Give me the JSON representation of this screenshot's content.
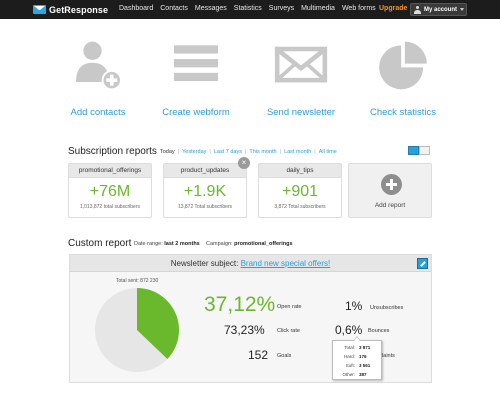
{
  "app": {
    "brand": "GetResponse",
    "brand_color": "#2aa8df"
  },
  "nav": {
    "items": [
      "Dashboard",
      "Contacts",
      "Messages",
      "Statistics",
      "Surveys",
      "Multimedia",
      "Web forms"
    ],
    "upgrade_label": "Upgrade",
    "account_label": "My account"
  },
  "actions": [
    {
      "label": "Add contacts",
      "icon": "add-contact-icon"
    },
    {
      "label": "Create webform",
      "icon": "webform-icon"
    },
    {
      "label": "Send newsletter",
      "icon": "envelope-icon"
    },
    {
      "label": "Check statistics",
      "icon": "pie-chart-icon"
    }
  ],
  "subscription": {
    "title": "Subscription reports",
    "periods": [
      "Today",
      "Yesterday",
      "Last 7 days",
      "This month",
      "Last month",
      "All time"
    ],
    "cards": [
      {
        "name": "promotional_offerings",
        "delta": "+76M",
        "subtitle": "1,013,872 total subscribers"
      },
      {
        "name": "product_updates",
        "delta": "+1.9K",
        "subtitle": "13,872 Total subscribers"
      },
      {
        "name": "daily_tips",
        "delta": "+901",
        "subtitle": "3,872 Total subscribers"
      }
    ],
    "add_label": "Add report",
    "close_glyph": "×"
  },
  "custom": {
    "title": "Custom report",
    "date_range_label": "Date range:",
    "date_range_value": "last 2 months",
    "campaign_label": "Campaign:",
    "campaign_value": "promotional_offerings",
    "subject_prefix": "Newsletter subject:",
    "subject_link": "Brand new special offers!",
    "total_sent": "Total sent: 872 230",
    "open_rate_fraction": 0.3712,
    "open_rate": "37,12%",
    "open_rate_label": "Open rate",
    "click_rate": "73,23%",
    "click_rate_label": "Click rate",
    "goals": "152",
    "goals_label": "Goals",
    "unsub_value": "1%",
    "unsub_label": "Unsubscribes",
    "bounce_value": "0,6%",
    "bounce_label": "Bounces",
    "complaints_label": "plaints",
    "tooltip": [
      {
        "k": "Total:",
        "v": "3 871"
      },
      {
        "k": "Hard:",
        "v": "176"
      },
      {
        "k": "Soft:",
        "v": "3 561"
      },
      {
        "k": "Other:",
        "v": "387"
      }
    ]
  },
  "colors": {
    "accent": "#2a9fd8",
    "green": "#6ab82c",
    "icon_gray": "#c8c8c8",
    "topbar": "#1c1c1c",
    "upgrade": "#f7941d"
  }
}
